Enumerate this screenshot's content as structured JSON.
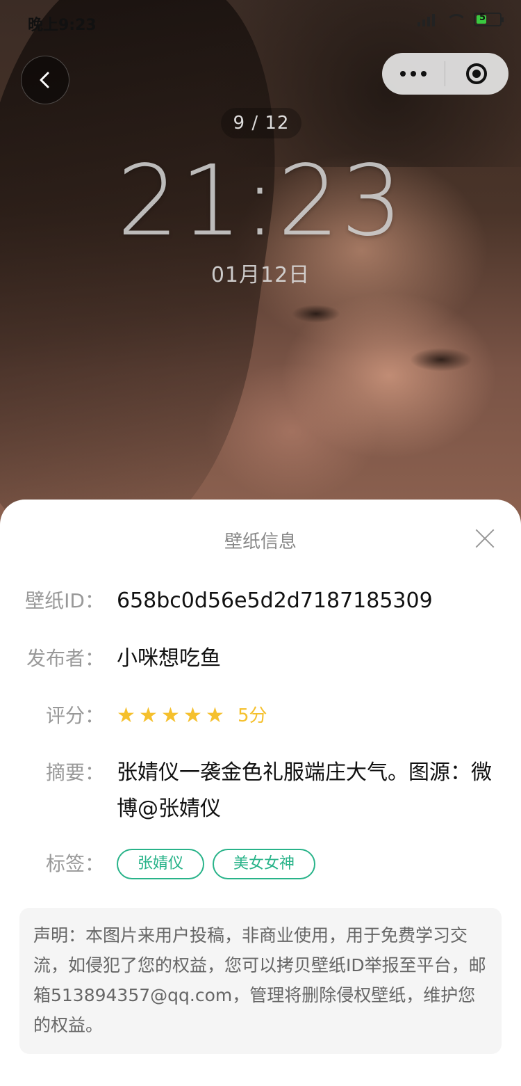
{
  "status_bar": {
    "time": "晚上9:23",
    "battery_level": "5"
  },
  "nav": {
    "back_icon": "chevron-left-icon",
    "more_icon": "more-dots-icon",
    "target_icon": "target-icon"
  },
  "preview": {
    "page_counter": "9 / 12",
    "clock_time": "21:23",
    "date": "01月12日"
  },
  "info": {
    "title": "壁纸信息",
    "rows": {
      "id_label": "壁纸ID：",
      "id_value": "658bc0d56e5d2d7187185309",
      "publisher_label": "发布者：",
      "publisher_value": "小咪想吃鱼",
      "rating_label": "评分：",
      "rating_score": "5分",
      "rating_stars": 5,
      "summary_label": "摘要：",
      "summary_value": "张婧仪一袭金色礼服端庄大气。图源：微博@张婧仪",
      "tags_label": "标签："
    },
    "tags": [
      "张婧仪",
      "美女女神"
    ],
    "notice": "声明：本图片来用户投稿，非商业使用，用于免费学习交流，如侵犯了您的权益，您可以拷贝壁纸ID举报至平台，邮箱513894357@qq.com，管理将删除侵权壁纸，维护您的权益。"
  },
  "colors": {
    "accent_green": "#28b389",
    "star_yellow": "#f5c02d"
  }
}
